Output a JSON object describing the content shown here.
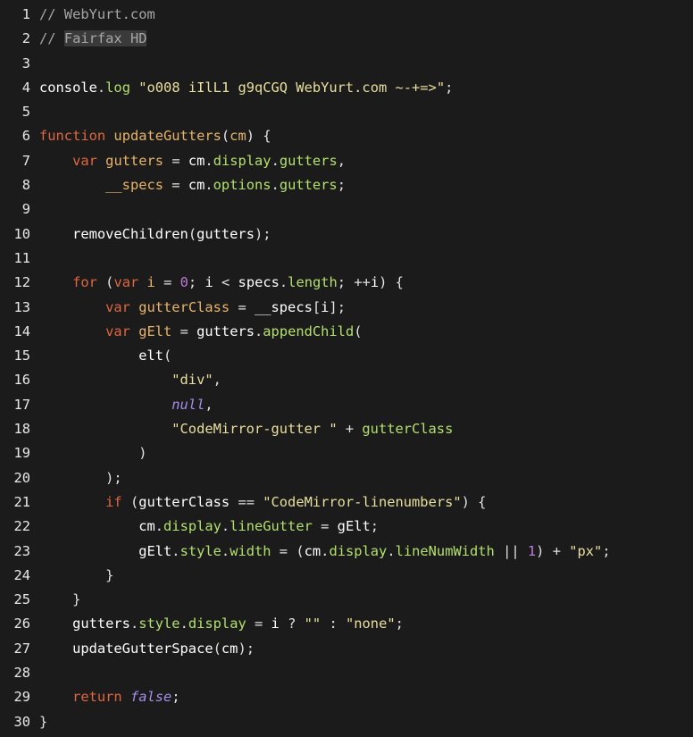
{
  "editor": {
    "line_numbers": [
      "1",
      "2",
      "3",
      "4",
      "5",
      "6",
      "7",
      "8",
      "9",
      "10",
      "11",
      "12",
      "13",
      "14",
      "15",
      "16",
      "17",
      "18",
      "19",
      "20",
      "21",
      "22",
      "23",
      "24",
      "25",
      "26",
      "27",
      "28",
      "29",
      "30"
    ],
    "lines": [
      [
        {
          "t": "// WebYurt.com",
          "c": "comment"
        }
      ],
      [
        {
          "t": "// ",
          "c": "comment"
        },
        {
          "t": "Fairfax HD",
          "c": "comment hl"
        }
      ],
      [],
      [
        {
          "t": "console",
          "c": "var"
        },
        {
          "t": ".",
          "c": "punct"
        },
        {
          "t": "log",
          "c": "prop"
        },
        {
          "t": " ",
          "c": "punct"
        },
        {
          "t": "\"o008 iIlL1 g9qCGQ WebYurt.com ~-+=>\"",
          "c": "string"
        },
        {
          "t": ";",
          "c": "punct"
        }
      ],
      [],
      [
        {
          "t": "function",
          "c": "keyword"
        },
        {
          "t": " ",
          "c": "punct"
        },
        {
          "t": "updateGutters",
          "c": "def"
        },
        {
          "t": "(",
          "c": "punct"
        },
        {
          "t": "cm",
          "c": "def"
        },
        {
          "t": ") {",
          "c": "punct"
        }
      ],
      [
        {
          "t": "    ",
          "c": "punct"
        },
        {
          "t": "var",
          "c": "keyword"
        },
        {
          "t": " ",
          "c": "punct"
        },
        {
          "t": "gutters",
          "c": "def"
        },
        {
          "t": " = ",
          "c": "punct"
        },
        {
          "t": "cm",
          "c": "var"
        },
        {
          "t": ".",
          "c": "punct"
        },
        {
          "t": "display",
          "c": "prop"
        },
        {
          "t": ".",
          "c": "punct"
        },
        {
          "t": "gutters",
          "c": "prop"
        },
        {
          "t": ",",
          "c": "punct"
        }
      ],
      [
        {
          "t": "        ",
          "c": "punct"
        },
        {
          "t": "__specs",
          "c": "def"
        },
        {
          "t": " = ",
          "c": "punct"
        },
        {
          "t": "cm",
          "c": "var"
        },
        {
          "t": ".",
          "c": "punct"
        },
        {
          "t": "options",
          "c": "prop"
        },
        {
          "t": ".",
          "c": "punct"
        },
        {
          "t": "gutters",
          "c": "prop"
        },
        {
          "t": ";",
          "c": "punct"
        }
      ],
      [],
      [
        {
          "t": "    ",
          "c": "punct"
        },
        {
          "t": "removeChildren",
          "c": "var"
        },
        {
          "t": "(",
          "c": "punct"
        },
        {
          "t": "gutters",
          "c": "var"
        },
        {
          "t": ");",
          "c": "punct"
        }
      ],
      [],
      [
        {
          "t": "    ",
          "c": "punct"
        },
        {
          "t": "for",
          "c": "keyword"
        },
        {
          "t": " (",
          "c": "punct"
        },
        {
          "t": "var",
          "c": "keyword"
        },
        {
          "t": " ",
          "c": "punct"
        },
        {
          "t": "i",
          "c": "def"
        },
        {
          "t": " = ",
          "c": "punct"
        },
        {
          "t": "0",
          "c": "number"
        },
        {
          "t": "; ",
          "c": "punct"
        },
        {
          "t": "i",
          "c": "var"
        },
        {
          "t": " < ",
          "c": "punct"
        },
        {
          "t": "specs",
          "c": "var"
        },
        {
          "t": ".",
          "c": "punct"
        },
        {
          "t": "length",
          "c": "prop"
        },
        {
          "t": "; ++",
          "c": "punct"
        },
        {
          "t": "i",
          "c": "var"
        },
        {
          "t": ") {",
          "c": "punct"
        }
      ],
      [
        {
          "t": "        ",
          "c": "punct"
        },
        {
          "t": "var",
          "c": "keyword"
        },
        {
          "t": " ",
          "c": "punct"
        },
        {
          "t": "gutterClass",
          "c": "def"
        },
        {
          "t": " = ",
          "c": "punct"
        },
        {
          "t": "__specs",
          "c": "var"
        },
        {
          "t": "[",
          "c": "punct"
        },
        {
          "t": "i",
          "c": "var"
        },
        {
          "t": "];",
          "c": "punct"
        }
      ],
      [
        {
          "t": "        ",
          "c": "punct"
        },
        {
          "t": "var",
          "c": "keyword"
        },
        {
          "t": " ",
          "c": "punct"
        },
        {
          "t": "gElt",
          "c": "def"
        },
        {
          "t": " = ",
          "c": "punct"
        },
        {
          "t": "gutters",
          "c": "var"
        },
        {
          "t": ".",
          "c": "punct"
        },
        {
          "t": "appendChild",
          "c": "prop"
        },
        {
          "t": "(",
          "c": "punct"
        }
      ],
      [
        {
          "t": "            ",
          "c": "punct"
        },
        {
          "t": "elt",
          "c": "var"
        },
        {
          "t": "(",
          "c": "punct"
        }
      ],
      [
        {
          "t": "                ",
          "c": "punct"
        },
        {
          "t": "\"div\"",
          "c": "string"
        },
        {
          "t": ",",
          "c": "punct"
        }
      ],
      [
        {
          "t": "                ",
          "c": "punct"
        },
        {
          "t": "null",
          "c": "atom"
        },
        {
          "t": ",",
          "c": "punct"
        }
      ],
      [
        {
          "t": "                ",
          "c": "punct"
        },
        {
          "t": "\"CodeMirror-gutter \"",
          "c": "string"
        },
        {
          "t": " + ",
          "c": "punct"
        },
        {
          "t": "gutterClass",
          "c": "prop"
        }
      ],
      [
        {
          "t": "            )",
          "c": "punct"
        }
      ],
      [
        {
          "t": "        );",
          "c": "punct"
        }
      ],
      [
        {
          "t": "        ",
          "c": "punct"
        },
        {
          "t": "if",
          "c": "keyword"
        },
        {
          "t": " (",
          "c": "punct"
        },
        {
          "t": "gutterClass",
          "c": "var"
        },
        {
          "t": " == ",
          "c": "punct"
        },
        {
          "t": "\"CodeMirror-linenumbers\"",
          "c": "string"
        },
        {
          "t": ") {",
          "c": "punct"
        }
      ],
      [
        {
          "t": "            ",
          "c": "punct"
        },
        {
          "t": "cm",
          "c": "var"
        },
        {
          "t": ".",
          "c": "punct"
        },
        {
          "t": "display",
          "c": "prop"
        },
        {
          "t": ".",
          "c": "punct"
        },
        {
          "t": "lineGutter",
          "c": "prop"
        },
        {
          "t": " = ",
          "c": "punct"
        },
        {
          "t": "gElt",
          "c": "var"
        },
        {
          "t": ";",
          "c": "punct"
        }
      ],
      [
        {
          "t": "            ",
          "c": "punct"
        },
        {
          "t": "gElt",
          "c": "var"
        },
        {
          "t": ".",
          "c": "punct"
        },
        {
          "t": "style",
          "c": "prop"
        },
        {
          "t": ".",
          "c": "punct"
        },
        {
          "t": "width",
          "c": "prop"
        },
        {
          "t": " = (",
          "c": "punct"
        },
        {
          "t": "cm",
          "c": "var"
        },
        {
          "t": ".",
          "c": "punct"
        },
        {
          "t": "display",
          "c": "prop"
        },
        {
          "t": ".",
          "c": "punct"
        },
        {
          "t": "lineNumWidth",
          "c": "prop"
        },
        {
          "t": " || ",
          "c": "punct"
        },
        {
          "t": "1",
          "c": "number"
        },
        {
          "t": ") + ",
          "c": "punct"
        },
        {
          "t": "\"px\"",
          "c": "string"
        },
        {
          "t": ";",
          "c": "punct"
        }
      ],
      [
        {
          "t": "        }",
          "c": "punct"
        }
      ],
      [
        {
          "t": "    }",
          "c": "punct"
        }
      ],
      [
        {
          "t": "    ",
          "c": "punct"
        },
        {
          "t": "gutters",
          "c": "var"
        },
        {
          "t": ".",
          "c": "punct"
        },
        {
          "t": "style",
          "c": "prop"
        },
        {
          "t": ".",
          "c": "punct"
        },
        {
          "t": "display",
          "c": "prop"
        },
        {
          "t": " = ",
          "c": "punct"
        },
        {
          "t": "i",
          "c": "var"
        },
        {
          "t": " ? ",
          "c": "punct"
        },
        {
          "t": "\"\"",
          "c": "string"
        },
        {
          "t": " : ",
          "c": "punct"
        },
        {
          "t": "\"none\"",
          "c": "string"
        },
        {
          "t": ";",
          "c": "punct"
        }
      ],
      [
        {
          "t": "    ",
          "c": "punct"
        },
        {
          "t": "updateGutterSpace",
          "c": "var"
        },
        {
          "t": "(",
          "c": "punct"
        },
        {
          "t": "cm",
          "c": "var"
        },
        {
          "t": ");",
          "c": "punct"
        }
      ],
      [],
      [
        {
          "t": "    ",
          "c": "punct"
        },
        {
          "t": "return",
          "c": "keyword"
        },
        {
          "t": " ",
          "c": "punct"
        },
        {
          "t": "false",
          "c": "atom"
        },
        {
          "t": ";",
          "c": "punct"
        }
      ],
      [
        {
          "t": "}",
          "c": "punct"
        }
      ]
    ]
  },
  "colors": {
    "background": "#1b1b1b",
    "comment": "#a6a6a6",
    "keyword": "#e0663f",
    "def": "#e9b46a",
    "string": "#e9df9e",
    "number": "#c17ad8",
    "atom": "#a58ee8",
    "property": "#b3e06d",
    "variable": "#ffffff"
  }
}
